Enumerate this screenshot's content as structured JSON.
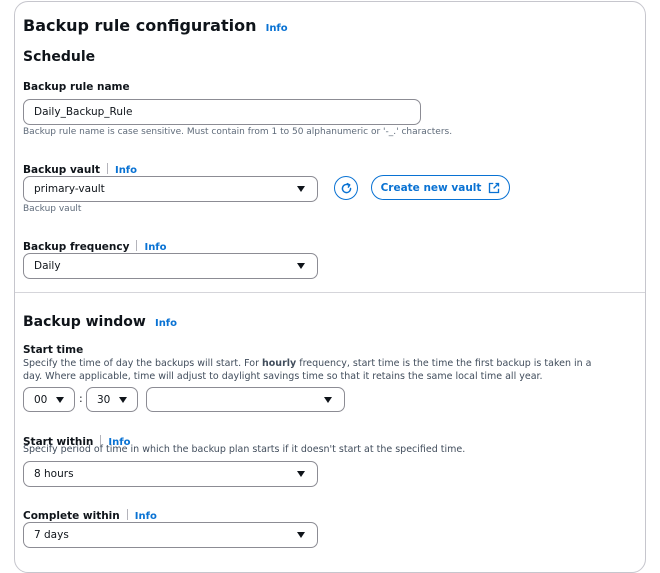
{
  "header": {
    "title": "Backup rule configuration",
    "info": "Info"
  },
  "schedule": {
    "title": "Schedule",
    "rule_name": {
      "label": "Backup rule name",
      "value": "Daily_Backup_Rule",
      "hint": "Backup rule name is case sensitive. Must contain from 1 to 50 alphanumeric or '-_.' characters."
    },
    "vault": {
      "label": "Backup vault",
      "info": "Info",
      "value": "primary-vault",
      "hint": "Backup vault",
      "refresh_icon": "refresh-icon",
      "create_label": "Create new vault",
      "create_icon": "external-link-icon"
    },
    "frequency": {
      "label": "Backup frequency",
      "info": "Info",
      "value": "Daily"
    }
  },
  "window": {
    "title": "Backup window",
    "info": "Info",
    "start_time": {
      "label": "Start time",
      "desc_before": "Specify the time of day the backups will start. For ",
      "desc_bold": "hourly",
      "desc_after": " frequency, start time is the time the first backup is taken in a day. Where applicable, time will adjust to daylight savings time so that it retains the same local time all year.",
      "hour": "00",
      "separator": ":",
      "minute": "30",
      "timezone": ""
    },
    "start_within": {
      "label": "Start within",
      "info": "Info",
      "desc": "Specify period of time in which the backup plan starts if it doesn't start at the specified time.",
      "value": "8 hours"
    },
    "complete_within": {
      "label": "Complete within",
      "info": "Info",
      "value": "7 days"
    }
  },
  "colors": {
    "accent": "#0972d3",
    "border": "#8c8c94",
    "text": "#0f141a"
  }
}
